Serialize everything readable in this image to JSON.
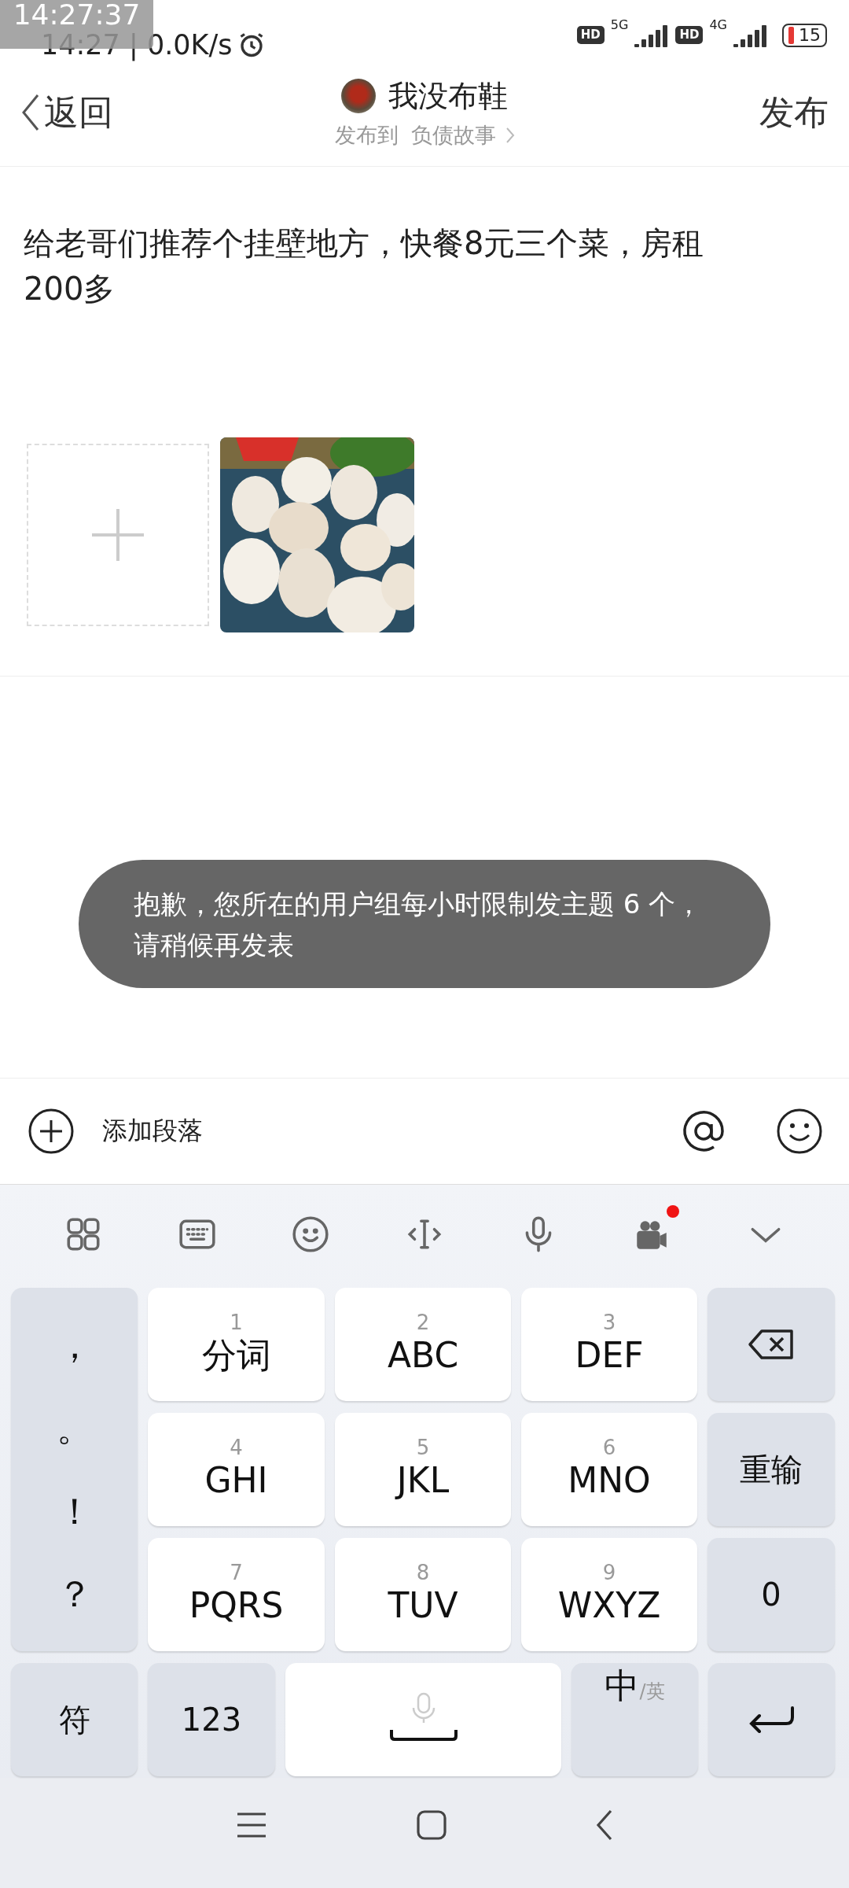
{
  "status_bar": {
    "overlay_clock": "14:27:37",
    "time_speed": "14:27 | 0.0K/s",
    "sims": [
      {
        "badge": "HD",
        "network": "5G"
      },
      {
        "badge": "HD",
        "network": "4G"
      }
    ],
    "battery": "15"
  },
  "header": {
    "back": "返回",
    "title": "我没布鞋",
    "publish_to": "发布到",
    "forum": "负债故事",
    "publish": "发布"
  },
  "post": {
    "text": "给老哥们推荐个挂壁地方，快餐8元三个菜，房租200多",
    "images": [
      {
        "kind": "add"
      },
      {
        "kind": "picture"
      }
    ]
  },
  "toast": "抱歉，您所在的用户组每小时限制发主题 6 个，请稍候再发表",
  "edit_bar": {
    "add_paragraph": "添加段落"
  },
  "keyboard": {
    "toolbar": [
      {
        "kind": "apps",
        "notification": false
      },
      {
        "kind": "keyboard",
        "notification": false
      },
      {
        "kind": "emoji",
        "notification": false
      },
      {
        "kind": "cursor",
        "notification": false
      },
      {
        "kind": "voice",
        "notification": false
      },
      {
        "kind": "camera",
        "notification": true
      },
      {
        "kind": "collapse",
        "notification": false
      }
    ],
    "punctuation": [
      "，",
      "。",
      "！",
      "？"
    ],
    "keys": [
      {
        "number": "1",
        "label": "分词"
      },
      {
        "number": "2",
        "label": "ABC"
      },
      {
        "number": "3",
        "label": "DEF"
      },
      {
        "number": "4",
        "label": "GHI"
      },
      {
        "number": "5",
        "label": "JKL"
      },
      {
        "number": "6",
        "label": "MNO"
      },
      {
        "number": "7",
        "label": "PQRS"
      },
      {
        "number": "8",
        "label": "TUV"
      },
      {
        "number": "9",
        "label": "WXYZ"
      }
    ],
    "side_keys": [
      {
        "kind": "backspace"
      },
      {
        "kind": "text",
        "label": "重输"
      },
      {
        "kind": "text",
        "label": "0"
      }
    ],
    "bottom_row": {
      "symbols": "符",
      "numbers": "123",
      "language": "中",
      "language_alt": "/英"
    }
  }
}
